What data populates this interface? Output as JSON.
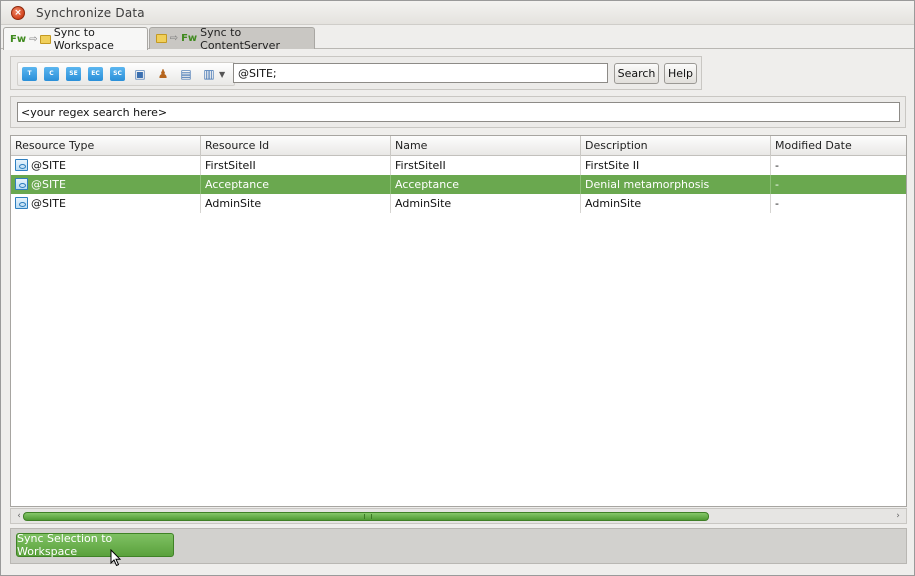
{
  "window": {
    "title": "Synchronize Data"
  },
  "tabs": [
    {
      "label": "Sync to Workspace",
      "active": true,
      "icon_badge": "Fw"
    },
    {
      "label": "Sync to ContentServer",
      "active": false,
      "icon_badge": "Fw"
    }
  ],
  "toolbar": {
    "buttons": [
      {
        "name": "template-icon",
        "label": "T"
      },
      {
        "name": "cssource-icon",
        "label": "C"
      },
      {
        "name": "sitelement-icon",
        "label": "SE"
      },
      {
        "name": "element-catalog-icon",
        "label": "EC"
      },
      {
        "name": "site-catalog-icon",
        "label": "SC"
      }
    ],
    "query_value": "@SITE;",
    "search_label": "Search",
    "help_label": "Help"
  },
  "regex": {
    "value": "<your regex search here>"
  },
  "table": {
    "columns": [
      "Resource Type",
      "Resource Id",
      "Name",
      "Description",
      "Modified Date"
    ],
    "rows": [
      {
        "type": "@SITE",
        "id": "FirstSiteII",
        "name": "FirstSiteII",
        "description": "FirstSite II",
        "modified": "-",
        "selected": false
      },
      {
        "type": "@SITE",
        "id": "Acceptance",
        "name": "Acceptance",
        "description": "Denial metamorphosis",
        "modified": "-",
        "selected": true
      },
      {
        "type": "@SITE",
        "id": "AdminSite",
        "name": "AdminSite",
        "description": "AdminSite",
        "modified": "-",
        "selected": false
      }
    ]
  },
  "actions": {
    "sync_label": "Sync Selection to Workspace"
  },
  "colors": {
    "selection": "#6aa84f",
    "accent_green": "#5aa13c",
    "close_button": "#d2421c"
  }
}
